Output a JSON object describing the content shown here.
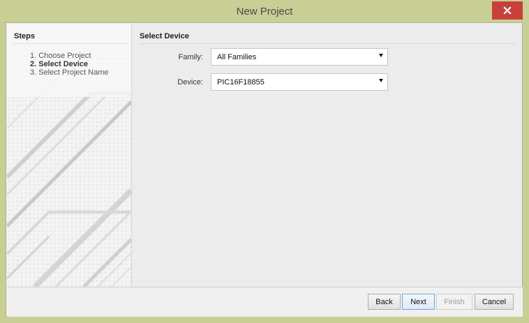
{
  "window": {
    "title": "New Project"
  },
  "steps": {
    "header": "Steps",
    "items": [
      {
        "label": "1. Choose Project",
        "active": false
      },
      {
        "label": "2. Select Device",
        "active": true
      },
      {
        "label": "3. Select Project Name",
        "active": false
      }
    ]
  },
  "select_device": {
    "title": "Select Device",
    "family": {
      "label": "Family:",
      "value": "All Families"
    },
    "device": {
      "label": "Device:",
      "value": "PIC16F18855"
    }
  },
  "footer": {
    "back": "Back",
    "next": "Next",
    "finish": "Finish",
    "cancel": "Cancel"
  },
  "colors": {
    "window_frame": "#c9cf94",
    "close_button": "#c7403a"
  }
}
